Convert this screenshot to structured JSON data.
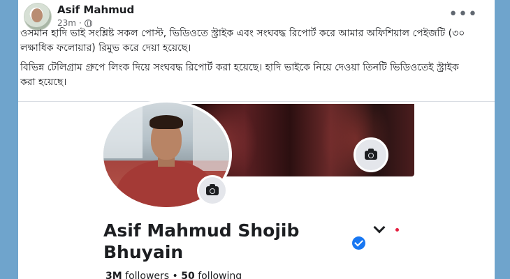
{
  "post": {
    "author": "Asif Mahmud",
    "time": "23m",
    "dot": "·",
    "more_label": "•••",
    "paragraphs": [
      "ওসমান হাদি ভাই সংশ্লিষ্ট সকল পোস্ট, ভিডিওতে স্ট্রাইক এবং সংঘবদ্ধ রিপোর্ট করে আমার অফিশিয়াল পেইজটি (৩০ লক্ষাধিক ফলোয়ার) রিমুভ করে দেয়া হয়েছে।",
      "বিভিন্ন টেলিগ্রাম গ্রুপে লিংক দিয়ে সংঘবদ্ধ রিপোর্ট করা হয়েছে। হাদি ভাইকে নিয়ে দেওয়া তিনটি ভিডিওতেই স্ট্রাইক করা হয়েছে।"
    ]
  },
  "profile": {
    "name": "Asif Mahmud Shojib Bhuyain",
    "followers_count": "3M",
    "followers_label": "followers",
    "separator": "•",
    "following_count": "50",
    "following_label": "following"
  },
  "colors": {
    "background": "#6fa4cc",
    "verified": "#1877f2",
    "notification_dot": "#e41e3f"
  },
  "icons": [
    "globe-icon",
    "more-options-icon",
    "camera-icon",
    "verified-badge-icon",
    "chevron-down-icon"
  ]
}
